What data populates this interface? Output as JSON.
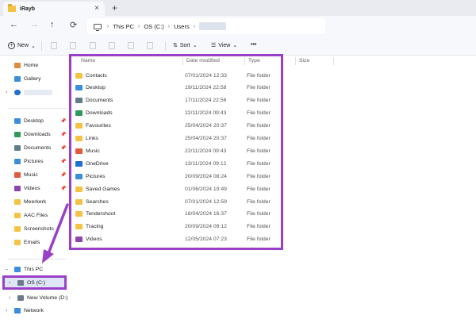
{
  "window": {
    "tab_title": "iRayb",
    "tab_close": "×",
    "new_tab": "+"
  },
  "nav": {
    "back": "←",
    "forward": "→",
    "up": "↑",
    "refresh": "⟳",
    "breadcrumbs": [
      "This PC",
      "OS (C:)",
      "Users"
    ],
    "separator": "›"
  },
  "commands": {
    "new_label": "New",
    "sort_label": "Sort",
    "view_label": "View",
    "more_label": "•••",
    "dropdown": "⌄"
  },
  "sidebar": {
    "top_items": [
      {
        "label": "Home",
        "icon": "home-icon",
        "color": "#e08a3c"
      },
      {
        "label": "Gallery",
        "icon": "gallery-icon",
        "color": "#3a8fd8"
      }
    ],
    "quick_access": [
      {
        "label": "Desktop",
        "icon": "desktop-icon",
        "color": "#3b8ede",
        "pin": "📌"
      },
      {
        "label": "Downloads",
        "icon": "download-icon",
        "color": "#2e9a5a",
        "pin": "📌"
      },
      {
        "label": "Documents",
        "icon": "documents-icon",
        "color": "#607d8b",
        "pin": "📌"
      },
      {
        "label": "Pictures",
        "icon": "pictures-icon",
        "color": "#3a8fd8",
        "pin": "📌"
      },
      {
        "label": "Music",
        "icon": "music-icon",
        "color": "#e05a3c",
        "pin": "📌"
      },
      {
        "label": "Videos",
        "icon": "videos-icon",
        "color": "#8e44ad",
        "pin": "📌"
      },
      {
        "label": "Meerkerk",
        "icon": "folder-icon",
        "color": "#f5c244",
        "pin": ""
      },
      {
        "label": "AAC Files",
        "icon": "folder-icon",
        "color": "#f5c244",
        "pin": ""
      },
      {
        "label": "Screenshots",
        "icon": "folder-icon",
        "color": "#f5c244",
        "pin": ""
      },
      {
        "label": "Emails",
        "icon": "folder-icon",
        "color": "#f5c244",
        "pin": ""
      }
    ],
    "this_pc": "This PC",
    "os_drive": "OS (C:)",
    "new_volume": "New Volume (D:)",
    "network": "Network"
  },
  "columns": {
    "name": "Name",
    "date": "Date modified",
    "type": "Type",
    "size": "Size"
  },
  "files": [
    {
      "name": "Contacts",
      "date": "07/01/2024 12:33",
      "type": "File folder",
      "icon": "folder-icon",
      "color": "#f5c244"
    },
    {
      "name": "Desktop",
      "date": "19/11/2024 22:58",
      "type": "File folder",
      "icon": "desktop-icon",
      "color": "#3b8ede"
    },
    {
      "name": "Documents",
      "date": "17/11/2024 22:56",
      "type": "File folder",
      "icon": "documents-icon",
      "color": "#607d8b"
    },
    {
      "name": "Downloads",
      "date": "22/11/2024 09:43",
      "type": "File folder",
      "icon": "download-icon",
      "color": "#2e9a5a"
    },
    {
      "name": "Favourites",
      "date": "25/04/2024 20:37",
      "type": "File folder",
      "icon": "folder-icon",
      "color": "#f5c244"
    },
    {
      "name": "Links",
      "date": "25/04/2024 20:37",
      "type": "File folder",
      "icon": "folder-icon",
      "color": "#f5c244"
    },
    {
      "name": "Music",
      "date": "22/11/2024 09:43",
      "type": "File folder",
      "icon": "music-icon",
      "color": "#e05a3c"
    },
    {
      "name": "OneDrive",
      "date": "13/11/2024 09:12",
      "type": "File folder",
      "icon": "onedrive-icon",
      "color": "#1e6fd0"
    },
    {
      "name": "Pictures",
      "date": "20/09/2024 08:24",
      "type": "File folder",
      "icon": "pictures-icon",
      "color": "#3a8fd8"
    },
    {
      "name": "Saved Games",
      "date": "01/06/2024 19:49",
      "type": "File folder",
      "icon": "folder-icon",
      "color": "#f5c244"
    },
    {
      "name": "Searches",
      "date": "07/01/2024 12:59",
      "type": "File folder",
      "icon": "folder-icon",
      "color": "#f5c244"
    },
    {
      "name": "Tendershoot",
      "date": "18/04/2024 16:37",
      "type": "File folder",
      "icon": "folder-icon",
      "color": "#f5c244"
    },
    {
      "name": "Tracing",
      "date": "20/09/2024 09:12",
      "type": "File folder",
      "icon": "folder-icon",
      "color": "#f5c244"
    },
    {
      "name": "Videos",
      "date": "12/05/2024 07:23",
      "type": "File folder",
      "icon": "videos-icon",
      "color": "#8e44ad"
    }
  ],
  "colors": {
    "highlight": "#9a40c8",
    "folder": "#f5c244"
  }
}
